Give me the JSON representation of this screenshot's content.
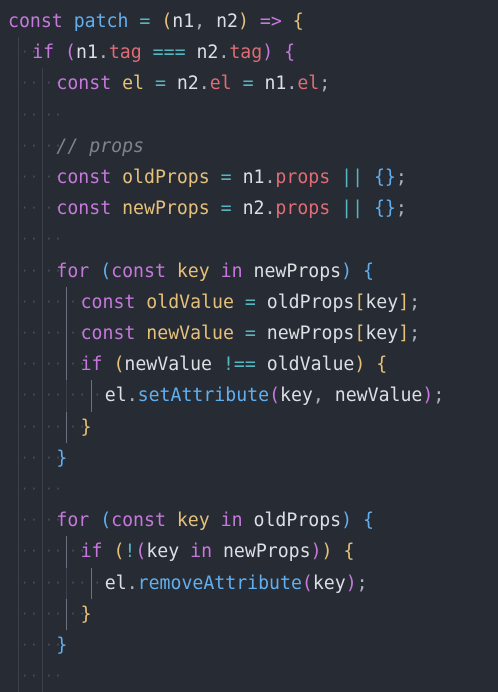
{
  "editor": {
    "colors": {
      "background": "#272b33",
      "keyword": "#c678dd",
      "function": "#61afef",
      "variable": "#e5c07b",
      "property": "#e06c75",
      "operator": "#56b6c2",
      "identifier": "#dcdfe4",
      "comment": "#7f848e"
    },
    "lines": [
      {
        "indent": 0,
        "tokens": [
          {
            "t": "const",
            "c": "kw"
          },
          {
            "t": " ",
            "c": "id"
          },
          {
            "t": "patch",
            "c": "fn"
          },
          {
            "t": " ",
            "c": "id"
          },
          {
            "t": "=",
            "c": "op"
          },
          {
            "t": " ",
            "c": "id"
          },
          {
            "t": "(",
            "c": "y"
          },
          {
            "t": "n1",
            "c": "id"
          },
          {
            "t": ", ",
            "c": "pn"
          },
          {
            "t": "n2",
            "c": "id"
          },
          {
            "t": ")",
            "c": "y"
          },
          {
            "t": " ",
            "c": "id"
          },
          {
            "t": "=>",
            "c": "kw"
          },
          {
            "t": " ",
            "c": "id"
          },
          {
            "t": "{",
            "c": "y"
          }
        ]
      },
      {
        "indent": 1,
        "tokens": [
          {
            "t": "if",
            "c": "kw"
          },
          {
            "t": " ",
            "c": "id"
          },
          {
            "t": "(",
            "c": "p"
          },
          {
            "t": "n1",
            "c": "id"
          },
          {
            "t": ".",
            "c": "pn"
          },
          {
            "t": "tag",
            "c": "prop"
          },
          {
            "t": " ",
            "c": "id"
          },
          {
            "t": "===",
            "c": "op"
          },
          {
            "t": " ",
            "c": "id"
          },
          {
            "t": "n2",
            "c": "id"
          },
          {
            "t": ".",
            "c": "pn"
          },
          {
            "t": "tag",
            "c": "prop"
          },
          {
            "t": ")",
            "c": "p"
          },
          {
            "t": " ",
            "c": "id"
          },
          {
            "t": "{",
            "c": "p"
          }
        ]
      },
      {
        "indent": 2,
        "tokens": [
          {
            "t": "const",
            "c": "kw"
          },
          {
            "t": " ",
            "c": "id"
          },
          {
            "t": "el",
            "c": "var"
          },
          {
            "t": " ",
            "c": "id"
          },
          {
            "t": "=",
            "c": "op"
          },
          {
            "t": " ",
            "c": "id"
          },
          {
            "t": "n2",
            "c": "id"
          },
          {
            "t": ".",
            "c": "pn"
          },
          {
            "t": "el",
            "c": "prop"
          },
          {
            "t": " ",
            "c": "id"
          },
          {
            "t": "=",
            "c": "op"
          },
          {
            "t": " ",
            "c": "id"
          },
          {
            "t": "n1",
            "c": "id"
          },
          {
            "t": ".",
            "c": "pn"
          },
          {
            "t": "el",
            "c": "prop"
          },
          {
            "t": ";",
            "c": "pn"
          }
        ]
      },
      {
        "indent": 2,
        "tokens": []
      },
      {
        "indent": 2,
        "tokens": [
          {
            "t": "// props",
            "c": "cm"
          }
        ]
      },
      {
        "indent": 2,
        "tokens": [
          {
            "t": "const",
            "c": "kw"
          },
          {
            "t": " ",
            "c": "id"
          },
          {
            "t": "oldProps",
            "c": "var"
          },
          {
            "t": " ",
            "c": "id"
          },
          {
            "t": "=",
            "c": "op"
          },
          {
            "t": " ",
            "c": "id"
          },
          {
            "t": "n1",
            "c": "id"
          },
          {
            "t": ".",
            "c": "pn"
          },
          {
            "t": "props",
            "c": "prop"
          },
          {
            "t": " ",
            "c": "id"
          },
          {
            "t": "||",
            "c": "op"
          },
          {
            "t": " ",
            "c": "id"
          },
          {
            "t": "{}",
            "c": "b"
          },
          {
            "t": ";",
            "c": "pn"
          }
        ]
      },
      {
        "indent": 2,
        "tokens": [
          {
            "t": "const",
            "c": "kw"
          },
          {
            "t": " ",
            "c": "id"
          },
          {
            "t": "newProps",
            "c": "var"
          },
          {
            "t": " ",
            "c": "id"
          },
          {
            "t": "=",
            "c": "op"
          },
          {
            "t": " ",
            "c": "id"
          },
          {
            "t": "n2",
            "c": "id"
          },
          {
            "t": ".",
            "c": "pn"
          },
          {
            "t": "props",
            "c": "prop"
          },
          {
            "t": " ",
            "c": "id"
          },
          {
            "t": "||",
            "c": "op"
          },
          {
            "t": " ",
            "c": "id"
          },
          {
            "t": "{}",
            "c": "b"
          },
          {
            "t": ";",
            "c": "pn"
          }
        ]
      },
      {
        "indent": 2,
        "tokens": []
      },
      {
        "indent": 2,
        "tokens": [
          {
            "t": "for",
            "c": "kw"
          },
          {
            "t": " ",
            "c": "id"
          },
          {
            "t": "(",
            "c": "b"
          },
          {
            "t": "const",
            "c": "kw"
          },
          {
            "t": " ",
            "c": "id"
          },
          {
            "t": "key",
            "c": "var"
          },
          {
            "t": " ",
            "c": "id"
          },
          {
            "t": "in",
            "c": "kw"
          },
          {
            "t": " ",
            "c": "id"
          },
          {
            "t": "newProps",
            "c": "id"
          },
          {
            "t": ")",
            "c": "b"
          },
          {
            "t": " ",
            "c": "id"
          },
          {
            "t": "{",
            "c": "b"
          }
        ]
      },
      {
        "indent": 3,
        "tokens": [
          {
            "t": "const",
            "c": "kw"
          },
          {
            "t": " ",
            "c": "id"
          },
          {
            "t": "oldValue",
            "c": "var"
          },
          {
            "t": " ",
            "c": "id"
          },
          {
            "t": "=",
            "c": "op"
          },
          {
            "t": " ",
            "c": "id"
          },
          {
            "t": "oldProps",
            "c": "id"
          },
          {
            "t": "[",
            "c": "y"
          },
          {
            "t": "key",
            "c": "id"
          },
          {
            "t": "]",
            "c": "y"
          },
          {
            "t": ";",
            "c": "pn"
          }
        ]
      },
      {
        "indent": 3,
        "tokens": [
          {
            "t": "const",
            "c": "kw"
          },
          {
            "t": " ",
            "c": "id"
          },
          {
            "t": "newValue",
            "c": "var"
          },
          {
            "t": " ",
            "c": "id"
          },
          {
            "t": "=",
            "c": "op"
          },
          {
            "t": " ",
            "c": "id"
          },
          {
            "t": "newProps",
            "c": "id"
          },
          {
            "t": "[",
            "c": "y"
          },
          {
            "t": "key",
            "c": "id"
          },
          {
            "t": "]",
            "c": "y"
          },
          {
            "t": ";",
            "c": "pn"
          }
        ]
      },
      {
        "indent": 3,
        "tokens": [
          {
            "t": "if",
            "c": "kw"
          },
          {
            "t": " ",
            "c": "id"
          },
          {
            "t": "(",
            "c": "y"
          },
          {
            "t": "newValue",
            "c": "id"
          },
          {
            "t": " ",
            "c": "id"
          },
          {
            "t": "!==",
            "c": "op"
          },
          {
            "t": " ",
            "c": "id"
          },
          {
            "t": "oldValue",
            "c": "id"
          },
          {
            "t": ")",
            "c": "y"
          },
          {
            "t": " ",
            "c": "id"
          },
          {
            "t": "{",
            "c": "y"
          }
        ]
      },
      {
        "indent": 4,
        "tokens": [
          {
            "t": "el",
            "c": "id"
          },
          {
            "t": ".",
            "c": "pn"
          },
          {
            "t": "setAttribute",
            "c": "fn"
          },
          {
            "t": "(",
            "c": "p"
          },
          {
            "t": "key",
            "c": "id"
          },
          {
            "t": ", ",
            "c": "pn"
          },
          {
            "t": "newValue",
            "c": "id"
          },
          {
            "t": ")",
            "c": "p"
          },
          {
            "t": ";",
            "c": "pn"
          }
        ]
      },
      {
        "indent": 3,
        "tokens": [
          {
            "t": "}",
            "c": "y"
          }
        ]
      },
      {
        "indent": 2,
        "tokens": [
          {
            "t": "}",
            "c": "b"
          }
        ]
      },
      {
        "indent": 2,
        "tokens": []
      },
      {
        "indent": 2,
        "tokens": [
          {
            "t": "for",
            "c": "kw"
          },
          {
            "t": " ",
            "c": "id"
          },
          {
            "t": "(",
            "c": "b"
          },
          {
            "t": "const",
            "c": "kw"
          },
          {
            "t": " ",
            "c": "id"
          },
          {
            "t": "key",
            "c": "var"
          },
          {
            "t": " ",
            "c": "id"
          },
          {
            "t": "in",
            "c": "kw"
          },
          {
            "t": " ",
            "c": "id"
          },
          {
            "t": "oldProps",
            "c": "id"
          },
          {
            "t": ")",
            "c": "b"
          },
          {
            "t": " ",
            "c": "id"
          },
          {
            "t": "{",
            "c": "b"
          }
        ]
      },
      {
        "indent": 3,
        "tokens": [
          {
            "t": "if",
            "c": "kw"
          },
          {
            "t": " ",
            "c": "id"
          },
          {
            "t": "(",
            "c": "y"
          },
          {
            "t": "!",
            "c": "op"
          },
          {
            "t": "(",
            "c": "p"
          },
          {
            "t": "key",
            "c": "id"
          },
          {
            "t": " ",
            "c": "id"
          },
          {
            "t": "in",
            "c": "kw"
          },
          {
            "t": " ",
            "c": "id"
          },
          {
            "t": "newProps",
            "c": "id"
          },
          {
            "t": ")",
            "c": "p"
          },
          {
            "t": ")",
            "c": "y"
          },
          {
            "t": " ",
            "c": "id"
          },
          {
            "t": "{",
            "c": "y"
          }
        ]
      },
      {
        "indent": 4,
        "tokens": [
          {
            "t": "el",
            "c": "id"
          },
          {
            "t": ".",
            "c": "pn"
          },
          {
            "t": "removeAttribute",
            "c": "fn"
          },
          {
            "t": "(",
            "c": "p"
          },
          {
            "t": "key",
            "c": "id"
          },
          {
            "t": ")",
            "c": "p"
          },
          {
            "t": ";",
            "c": "pn"
          }
        ]
      },
      {
        "indent": 3,
        "tokens": [
          {
            "t": "}",
            "c": "y"
          }
        ]
      },
      {
        "indent": 2,
        "tokens": [
          {
            "t": "}",
            "c": "b"
          }
        ]
      },
      {
        "indent": 2,
        "tokens": []
      }
    ]
  }
}
